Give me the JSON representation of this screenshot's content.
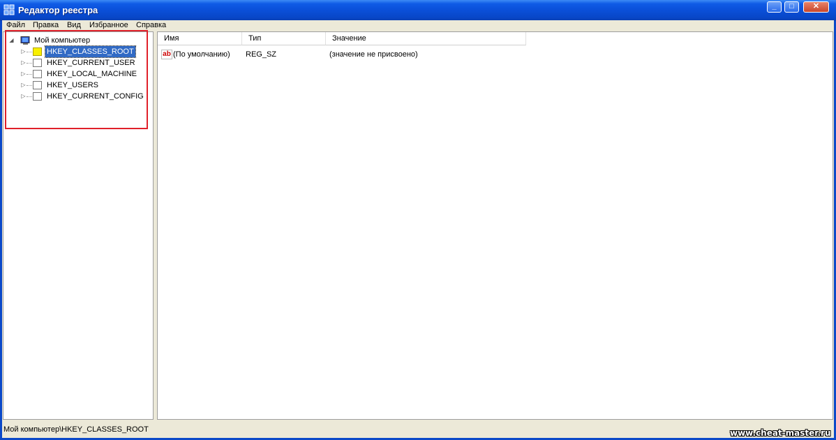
{
  "window": {
    "title": "Редактор реестра",
    "app_icon": "registry-editor-icon",
    "controls": {
      "minimize": "_",
      "maximize": "□",
      "close": "✕"
    }
  },
  "menu": [
    "Файл",
    "Правка",
    "Вид",
    "Избранное",
    "Справка"
  ],
  "tree": {
    "root": {
      "label": "Мой компьютер",
      "icon": "computer-icon",
      "expanded": true
    },
    "keys": [
      {
        "label": "HKEY_CLASSES_ROOT",
        "selected": true
      },
      {
        "label": "HKEY_CURRENT_USER",
        "selected": false
      },
      {
        "label": "HKEY_LOCAL_MACHINE",
        "selected": false
      },
      {
        "label": "HKEY_USERS",
        "selected": false
      },
      {
        "label": "HKEY_CURRENT_CONFIG",
        "selected": false
      }
    ]
  },
  "list": {
    "columns": [
      "Имя",
      "Тип",
      "Значение"
    ],
    "rows": [
      {
        "icon": "string-value-icon",
        "name": "(По умолчанию)",
        "type": "REG_SZ",
        "value": "(значение не присвоено)"
      }
    ]
  },
  "statusbar": {
    "path": "Мой компьютер\\HKEY_CLASSES_ROOT"
  },
  "watermark": "www.cheat-master.ru",
  "colors": {
    "titlebar": "#0a4fd8",
    "selection": "#316ac5",
    "highlight_box": "#e0202a",
    "folder_selected": "#f8f000"
  }
}
